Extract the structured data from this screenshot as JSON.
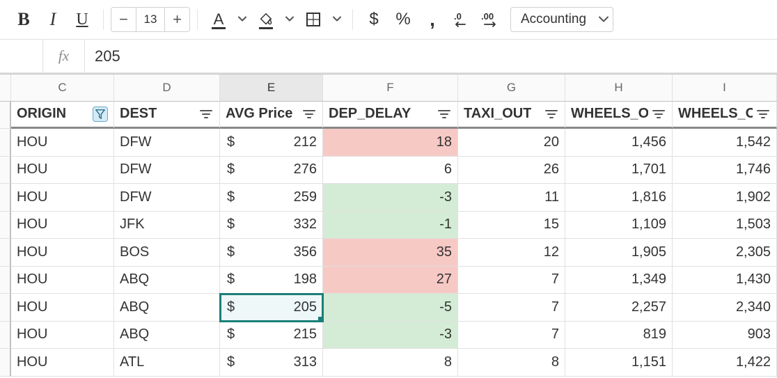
{
  "toolbar": {
    "font_size": "13",
    "format_label": "Accounting"
  },
  "formula": {
    "fx_label": "fx",
    "value": "205"
  },
  "columns": [
    {
      "letter": "C",
      "cls": "c-C",
      "header": "ORIGIN",
      "filter": "funnel"
    },
    {
      "letter": "D",
      "cls": "c-D",
      "header": "DEST",
      "filter": "bars"
    },
    {
      "letter": "E",
      "cls": "c-E",
      "header": "AVG Price",
      "filter": "bars",
      "selected": true
    },
    {
      "letter": "F",
      "cls": "c-F",
      "header": "DEP_DELAY",
      "filter": "bars"
    },
    {
      "letter": "G",
      "cls": "c-G",
      "header": "TAXI_OUT",
      "filter": "bars"
    },
    {
      "letter": "H",
      "cls": "c-H",
      "header": "WHEELS_OFF",
      "filter": "bars",
      "clip": "WHEELS_O"
    },
    {
      "letter": "I",
      "cls": "c-I",
      "header": "WHEELS_ON",
      "filter": "bars",
      "clip": "WHEELS_O"
    }
  ],
  "currency_symbol": "$",
  "rows": [
    {
      "origin": "HOU",
      "dest": "DFW",
      "price": "212",
      "dep_delay": "18",
      "dep_bg": "red",
      "taxi": "20",
      "woff": "1,456",
      "won": "1,542"
    },
    {
      "origin": "HOU",
      "dest": "DFW",
      "price": "276",
      "dep_delay": "6",
      "dep_bg": "",
      "taxi": "26",
      "woff": "1,701",
      "won": "1,746"
    },
    {
      "origin": "HOU",
      "dest": "DFW",
      "price": "259",
      "dep_delay": "-3",
      "dep_bg": "green",
      "taxi": "11",
      "woff": "1,816",
      "won": "1,902"
    },
    {
      "origin": "HOU",
      "dest": "JFK",
      "price": "332",
      "dep_delay": "-1",
      "dep_bg": "green",
      "taxi": "15",
      "woff": "1,109",
      "won": "1,503"
    },
    {
      "origin": "HOU",
      "dest": "BOS",
      "price": "356",
      "dep_delay": "35",
      "dep_bg": "red",
      "taxi": "12",
      "woff": "1,905",
      "won": "2,305"
    },
    {
      "origin": "HOU",
      "dest": "ABQ",
      "price": "198",
      "dep_delay": "27",
      "dep_bg": "red",
      "taxi": "7",
      "woff": "1,349",
      "won": "1,430"
    },
    {
      "origin": "HOU",
      "dest": "ABQ",
      "price": "205",
      "dep_delay": "-5",
      "dep_bg": "green",
      "taxi": "7",
      "woff": "2,257",
      "won": "2,340",
      "selected": true
    },
    {
      "origin": "HOU",
      "dest": "ABQ",
      "price": "215",
      "dep_delay": "-3",
      "dep_bg": "green",
      "taxi": "7",
      "woff": "819",
      "won": "903"
    },
    {
      "origin": "HOU",
      "dest": "ATL",
      "price": "313",
      "dep_delay": "8",
      "dep_bg": "",
      "taxi": "8",
      "woff": "1,151",
      "won": "1,422"
    }
  ]
}
